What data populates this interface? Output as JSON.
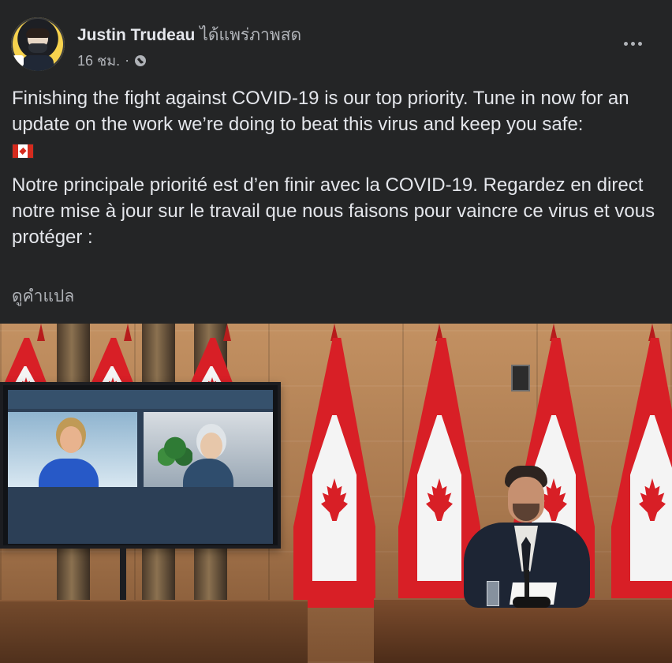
{
  "post": {
    "author": "Justin Trudeau",
    "live_status": "ได้แพร่ภาพสด",
    "time": "16 ชม.",
    "separator": "·",
    "privacy_icon": "globe-icon",
    "more_icon": "more-horizontal-icon",
    "text": {
      "english": "Finishing the fight against COVID-19 is our top priority. Tune in now for an update on the work we’re doing to beat this virus and keep you safe:",
      "flag": "canadian-flag-icon",
      "french": "Notre principale priorité est d’en finir avec la COVID-19. Regardez en direct notre mise à jour sur le travail que nous faisons pour vaincre ce virus et vous protéger :"
    },
    "translate_link": "ดูคำแปล"
  },
  "colors": {
    "background": "#242526",
    "primary_text": "#e4e6eb",
    "secondary_text": "#b0b3b8",
    "flag_red": "#d81f26"
  }
}
